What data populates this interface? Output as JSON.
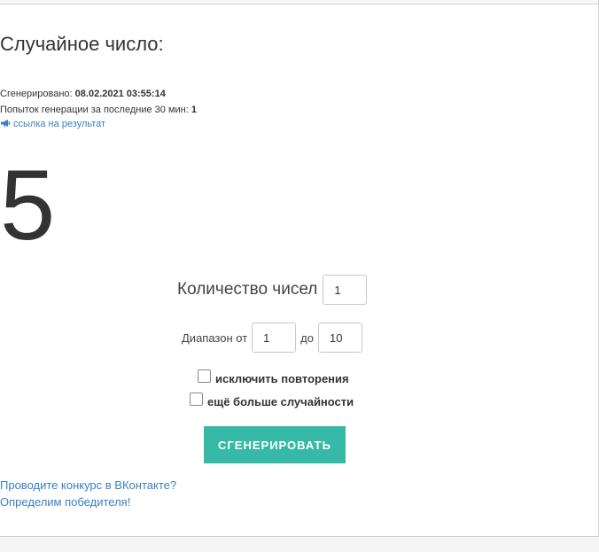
{
  "title": "Случайное число:",
  "meta": {
    "generated_label": "Сгенерировано:",
    "generated_value": "08.02.2021 03:55:14",
    "attempts_label": "Попыток генерации за последние 30 мин:",
    "attempts_value": "1"
  },
  "result_link": {
    "icon": "megaphone-icon",
    "label": "ссылка на результат"
  },
  "result": "5",
  "count": {
    "label": "Количество чисел",
    "value": "1"
  },
  "range": {
    "from_label": "Диапазон от",
    "from_value": "1",
    "to_label": "до",
    "to_value": "10"
  },
  "options": {
    "exclude_repeats": {
      "label": "исключить повторения",
      "checked": false
    },
    "more_random": {
      "label": "ещё больше случайности",
      "checked": false
    }
  },
  "generate_button": "СГЕНЕРИРОВАТЬ",
  "promo": {
    "line1": "Проводите конкурс в ВКонтакте?",
    "line2": "Определим победителя!"
  },
  "colors": {
    "accent": "#36b9a6",
    "link": "#3a7fc3",
    "text": "#333333"
  }
}
